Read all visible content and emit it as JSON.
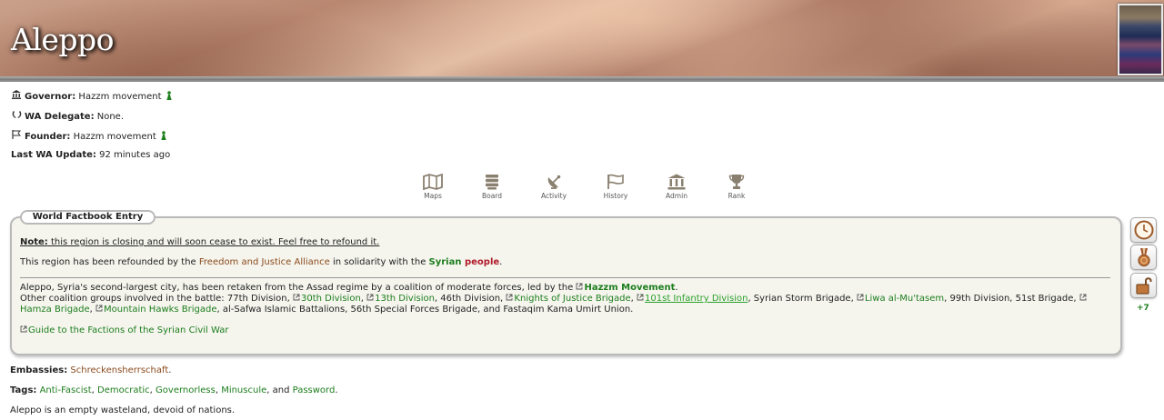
{
  "region": {
    "name": "Aleppo"
  },
  "info": {
    "governor_label": "Governor:",
    "governor_value": "Hazzm movement",
    "delegate_label": "WA Delegate:",
    "delegate_value": "None.",
    "founder_label": "Founder:",
    "founder_value": "Hazzm movement",
    "update_label": "Last WA Update:",
    "update_value": "92 minutes ago"
  },
  "nav": [
    {
      "label": "Maps",
      "icon": "map-icon"
    },
    {
      "label": "Board",
      "icon": "board-icon"
    },
    {
      "label": "Activity",
      "icon": "satellite-icon"
    },
    {
      "label": "History",
      "icon": "flag-icon"
    },
    {
      "label": "Admin",
      "icon": "building-icon"
    },
    {
      "label": "Rank",
      "icon": "trophy-icon"
    }
  ],
  "factbook": {
    "tab_label": "World Factbook Entry",
    "note_label": "Note:",
    "note_text": " this region is closing and will soon cease to exist. Feel free to refound it.",
    "refound_pre": "This region has been refounded by the ",
    "refound_link": "Freedom and Justice Alliance",
    "refound_mid": " in solidarity with the ",
    "syrian": "Syrian",
    "people": "people",
    "period": ".",
    "para1_pre": "Aleppo, Syria's second-largest city, has been retaken from the Assad regime by a coalition of moderate forces, led by the ",
    "para1_link": "Hazzm Movement",
    "para1_end": ".",
    "para2_pre": "Other coalition groups involved in the battle: 77th Division, ",
    "l_30th": "30th Division",
    "sep_comma": ", ",
    "l_13th": "13th Division",
    "t_46th": ", 46th Division, ",
    "l_knights": "Knights of Justice Brigade",
    "l_101st": "101st Infantry Division",
    "t_storm": ", Syrian Storm Brigade, ",
    "l_liwa": "Liwa al-Mu'tasem",
    "t_99th": ", 99th Division, 51st Brigade, ",
    "l_hamza": "Hamza Brigade",
    "l_hawks": "Mountain Hawks Brigade",
    "t_end": ", al-Safwa Islamic Battalions, 56th Special Forces Brigade, and Fastaqim Kama Umirt Union.",
    "guide_link": "Guide to the Factions of the Syrian Civil War"
  },
  "badges": {
    "more_label": "+7"
  },
  "embassies": {
    "label": "Embassies:",
    "value": "Schreckensherrschaft",
    "end": "."
  },
  "tags": {
    "label": "Tags:",
    "items": [
      "Anti-Fascist",
      "Democratic",
      "Governorless",
      "Minuscule",
      "Password"
    ],
    "sep": ", ",
    "and": ", and ",
    "end": "."
  },
  "status_text": "Aleppo is an empty wasteland, devoid of nations.",
  "colors": {
    "link_green": "#1d7d1d",
    "link_brown": "#8b4a1c",
    "people_red": "#b01a2a",
    "box_bg": "#f5f5ee"
  }
}
